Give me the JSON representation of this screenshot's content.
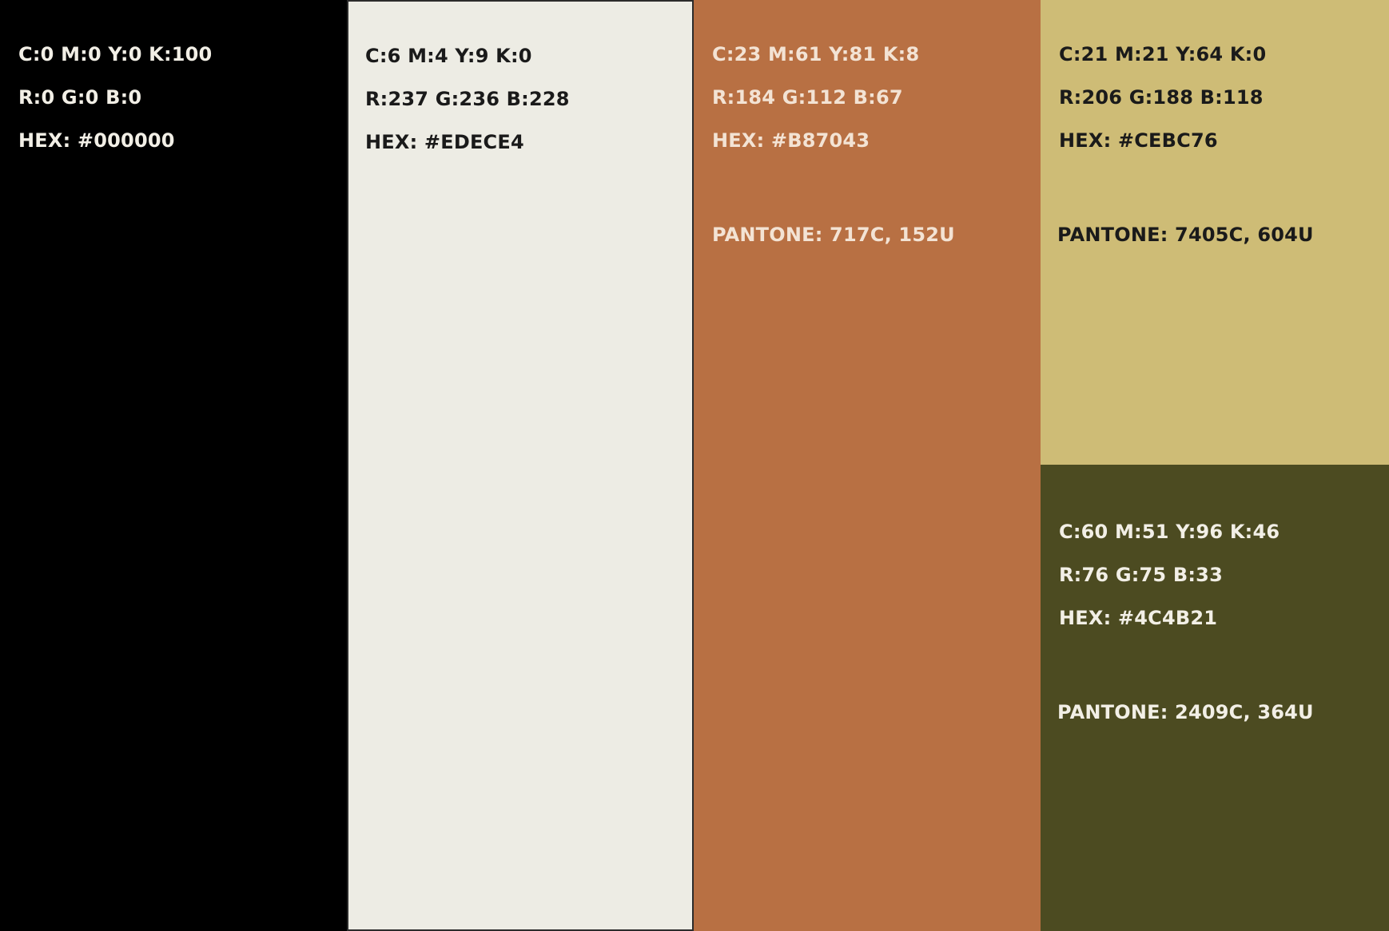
{
  "swatches": {
    "black": {
      "color": "#000000",
      "cmyk": "C:0 M:0 Y:0 K:100",
      "rgb": "R:0 G:0 B:0",
      "hex": "HEX: #000000"
    },
    "cream": {
      "color": "#EDECE4",
      "cmyk": "C:6 M:4 Y:9 K:0",
      "rgb": "R:237 G:236 B:228",
      "hex": "HEX: #EDECE4"
    },
    "copper": {
      "color": "#B87043",
      "cmyk": "C:23 M:61 Y:81 K:8",
      "rgb": "R:184 G:112 B:67",
      "hex": "HEX: #B87043",
      "pantone": "PANTONE: 717C, 152U"
    },
    "sand": {
      "color": "#CEBC76",
      "cmyk": "C:21 M:21 Y:64 K:0",
      "rgb": "R:206 G:188 B:118",
      "hex": "HEX: #CEBC76",
      "pantone": "PANTONE: 7405C, 604U"
    },
    "olive": {
      "color": "#4C4B21",
      "cmyk": "C:60 M:51 Y:96 K:46",
      "rgb": "R:76 G:75 B:33",
      "hex": "HEX: #4C4B21",
      "pantone": "PANTONE: 2409C, 364U"
    }
  }
}
